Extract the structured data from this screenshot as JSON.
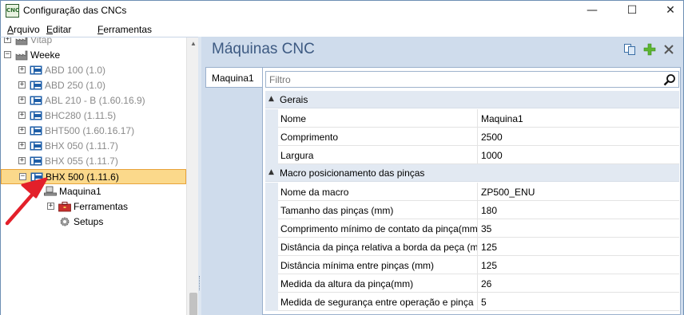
{
  "window": {
    "title": "Configuração das CNCs",
    "app_icon_text": "CNC",
    "minimize_glyph": "—",
    "maximize_glyph": "☐",
    "close_glyph": "✕"
  },
  "menu": {
    "items": [
      {
        "underline": "A",
        "rest": "rquivo"
      },
      {
        "underline": "E",
        "rest": "ditar"
      },
      {
        "underline": "F",
        "rest": "erramentas"
      }
    ]
  },
  "tree": {
    "items": [
      {
        "label": "Vitap",
        "level": 0,
        "expander": "+",
        "icon": "factory-icon",
        "greyed": true,
        "selected": false
      },
      {
        "label": "Weeke",
        "level": 0,
        "expander": "−",
        "icon": "factory-icon",
        "greyed": false,
        "selected": false
      },
      {
        "label": "ABD 100 (1.0)",
        "level": 1,
        "expander": "+",
        "icon": "machine-icon",
        "greyed": true,
        "selected": false
      },
      {
        "label": "ABD 250 (1.0)",
        "level": 1,
        "expander": "+",
        "icon": "machine-icon",
        "greyed": true,
        "selected": false
      },
      {
        "label": "ABL 210 - B (1.60.16.9)",
        "level": 1,
        "expander": "+",
        "icon": "machine-icon",
        "greyed": true,
        "selected": false
      },
      {
        "label": "BHC280 (1.11.5)",
        "level": 1,
        "expander": "+",
        "icon": "machine-icon",
        "greyed": true,
        "selected": false
      },
      {
        "label": "BHT500 (1.60.16.17)",
        "level": 1,
        "expander": "+",
        "icon": "machine-icon",
        "greyed": true,
        "selected": false
      },
      {
        "label": "BHX 050 (1.11.7)",
        "level": 1,
        "expander": "+",
        "icon": "machine-icon",
        "greyed": true,
        "selected": false
      },
      {
        "label": "BHX 055 (1.11.7)",
        "level": 1,
        "expander": "+",
        "icon": "machine-icon",
        "greyed": true,
        "selected": false
      },
      {
        "label": "BHX 500 (1.11.6)",
        "level": 1,
        "expander": "−",
        "icon": "machine-icon",
        "greyed": false,
        "selected": true
      },
      {
        "label": "Maquina1",
        "level": 2,
        "expander": "",
        "icon": "workstation-icon",
        "greyed": false,
        "selected": false
      },
      {
        "label": "Ferramentas",
        "level": 3,
        "expander": "+",
        "icon": "toolbox-icon",
        "greyed": false,
        "selected": false
      },
      {
        "label": "Setups",
        "level": 3,
        "expander": "",
        "icon": "gear-icon",
        "greyed": false,
        "selected": false
      }
    ]
  },
  "pane": {
    "title": "Máquinas CNC",
    "tab_label": "Maquina1",
    "filter_placeholder": "Filtro",
    "categories": [
      {
        "label": "Gerais",
        "properties": [
          {
            "name": "Nome",
            "value": "Maquina1"
          },
          {
            "name": "Comprimento",
            "value": "2500"
          },
          {
            "name": "Largura",
            "value": "1000"
          }
        ]
      },
      {
        "label": "Macro posicionamento das pinças",
        "properties": [
          {
            "name": "Nome da macro",
            "value": "ZP500_ENU"
          },
          {
            "name": "Tamanho das pinças (mm)",
            "value": "180"
          },
          {
            "name": "Comprimento mínimo de contato da pinça(mm).",
            "value": "35"
          },
          {
            "name": "Distância da pinça relativa a borda da peça (mm)",
            "value": "125"
          },
          {
            "name": "Distância mínima entre pinças (mm)",
            "value": "125"
          },
          {
            "name": "Medida da altura da pinça(mm)",
            "value": "26"
          },
          {
            "name": "Medida de segurança entre operação e pinça",
            "value": "5"
          }
        ]
      }
    ]
  },
  "colors": {
    "selection_fill": "#fbd98b",
    "selection_border": "#e8a33a",
    "pane_background": "#cfdcec",
    "title_color": "#3d5a82",
    "annotation_arrow": "#e3202a"
  }
}
